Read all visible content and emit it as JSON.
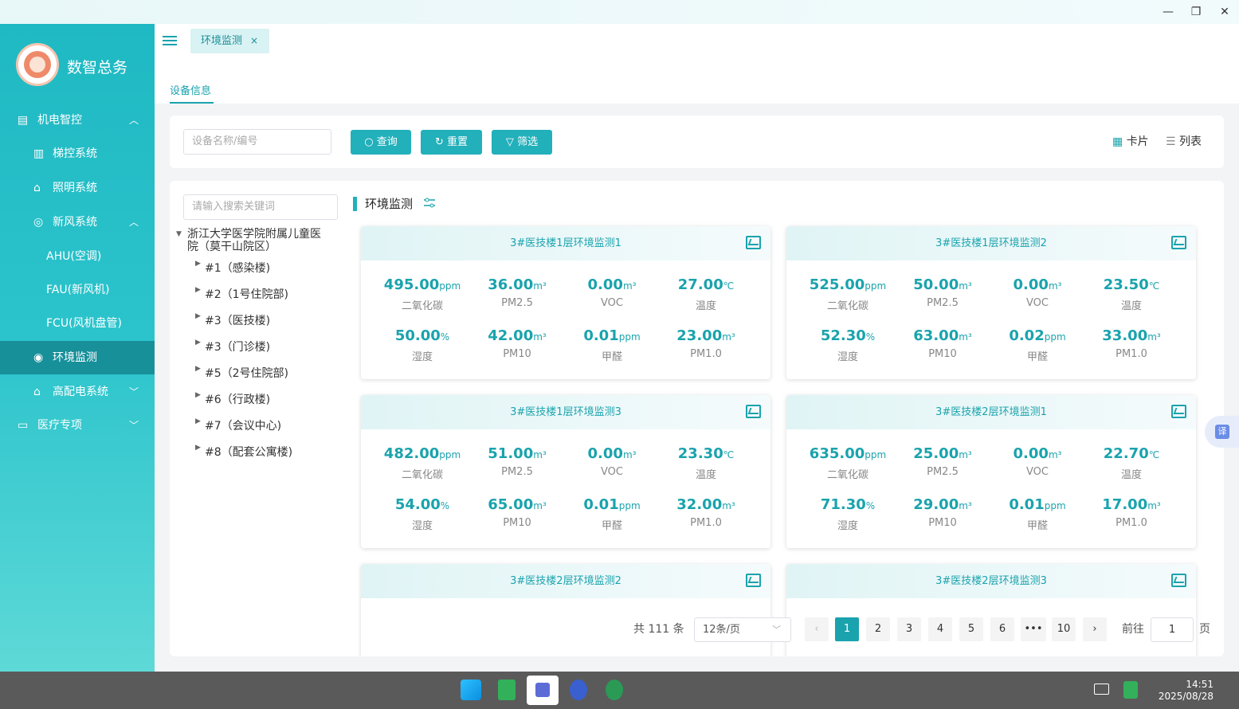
{
  "window": {
    "minimize": "—",
    "restore": "❐",
    "close": "✕"
  },
  "brand": "数智总务",
  "sidebar": {
    "items": [
      {
        "label": "机电智控",
        "icon": "building-icon",
        "chevron": "︿",
        "level": 1
      },
      {
        "label": "梯控系统",
        "icon": "elevator-icon",
        "level": 2
      },
      {
        "label": "照明系统",
        "icon": "lighting-icon",
        "level": 2
      },
      {
        "label": "新风系统",
        "icon": "fresh-air-icon",
        "chevron": "︿",
        "level": 2
      },
      {
        "label": "AHU(空调)",
        "level": 3
      },
      {
        "label": "FAU(新风机)",
        "level": 3
      },
      {
        "label": "FCU(风机盘管)",
        "level": 3
      },
      {
        "label": "环境监测",
        "icon": "eye-icon",
        "level": 2,
        "active": true
      },
      {
        "label": "高配电系统",
        "icon": "power-icon",
        "chevron": "﹀",
        "level": 2
      },
      {
        "label": "医疗专项",
        "icon": "monitor-icon",
        "chevron": "﹀",
        "level": 1
      }
    ]
  },
  "tabs": [
    {
      "label": "环境监测",
      "close": "×"
    }
  ],
  "subtab": "设备信息",
  "toolbar": {
    "search_placeholder": "设备名称/编号",
    "query_label": "查询",
    "reset_label": "重置",
    "filter_label": "筛选",
    "card_view": "卡片",
    "list_view": "列表"
  },
  "tree": {
    "search_placeholder": "请输入搜索关键词",
    "root": "浙江大学医学院附属儿童医院（莫干山院区）",
    "nodes": [
      "#1（感染楼)",
      "#2（1号住院部)",
      "#3（医技楼)",
      "#3（门诊楼)",
      "#5（2号住院部)",
      "#6（行政楼)",
      "#7（会议中心)",
      "#8（配套公寓楼)"
    ]
  },
  "section_title": "环境监测",
  "cards": [
    {
      "title": "3#医技楼1层环境监测1",
      "metrics": [
        {
          "value": "495.00",
          "unit": "ppm",
          "label": "二氧化碳"
        },
        {
          "value": "36.00",
          "unit": "m³",
          "label": "PM2.5"
        },
        {
          "value": "0.00",
          "unit": "m³",
          "label": "VOC"
        },
        {
          "value": "27.00",
          "unit": "℃",
          "label": "温度"
        },
        {
          "value": "50.00",
          "unit": "%",
          "label": "湿度"
        },
        {
          "value": "42.00",
          "unit": "m³",
          "label": "PM10"
        },
        {
          "value": "0.01",
          "unit": "ppm",
          "label": "甲醛"
        },
        {
          "value": "23.00",
          "unit": "m³",
          "label": "PM1.0"
        }
      ]
    },
    {
      "title": "3#医技楼1层环境监测2",
      "metrics": [
        {
          "value": "525.00",
          "unit": "ppm",
          "label": "二氧化碳"
        },
        {
          "value": "50.00",
          "unit": "m³",
          "label": "PM2.5"
        },
        {
          "value": "0.00",
          "unit": "m³",
          "label": "VOC"
        },
        {
          "value": "23.50",
          "unit": "℃",
          "label": "温度"
        },
        {
          "value": "52.30",
          "unit": "%",
          "label": "湿度"
        },
        {
          "value": "63.00",
          "unit": "m³",
          "label": "PM10"
        },
        {
          "value": "0.02",
          "unit": "ppm",
          "label": "甲醛"
        },
        {
          "value": "33.00",
          "unit": "m³",
          "label": "PM1.0"
        }
      ]
    },
    {
      "title": "3#医技楼1层环境监测3",
      "metrics": [
        {
          "value": "482.00",
          "unit": "ppm",
          "label": "二氧化碳"
        },
        {
          "value": "51.00",
          "unit": "m³",
          "label": "PM2.5"
        },
        {
          "value": "0.00",
          "unit": "m³",
          "label": "VOC"
        },
        {
          "value": "23.30",
          "unit": "℃",
          "label": "温度"
        },
        {
          "value": "54.00",
          "unit": "%",
          "label": "湿度"
        },
        {
          "value": "65.00",
          "unit": "m³",
          "label": "PM10"
        },
        {
          "value": "0.01",
          "unit": "ppm",
          "label": "甲醛"
        },
        {
          "value": "32.00",
          "unit": "m³",
          "label": "PM1.0"
        }
      ]
    },
    {
      "title": "3#医技楼2层环境监测1",
      "metrics": [
        {
          "value": "635.00",
          "unit": "ppm",
          "label": "二氧化碳"
        },
        {
          "value": "25.00",
          "unit": "m³",
          "label": "PM2.5"
        },
        {
          "value": "0.00",
          "unit": "m³",
          "label": "VOC"
        },
        {
          "value": "22.70",
          "unit": "℃",
          "label": "温度"
        },
        {
          "value": "71.30",
          "unit": "%",
          "label": "湿度"
        },
        {
          "value": "29.00",
          "unit": "m³",
          "label": "PM10"
        },
        {
          "value": "0.01",
          "unit": "ppm",
          "label": "甲醛"
        },
        {
          "value": "17.00",
          "unit": "m³",
          "label": "PM1.0"
        }
      ]
    },
    {
      "title": "3#医技楼2层环境监测2",
      "metrics": []
    },
    {
      "title": "3#医技楼2层环境监测3",
      "metrics": []
    }
  ],
  "pagination": {
    "total": "共 111 条",
    "page_size": "12条/页",
    "pages": [
      "1",
      "2",
      "3",
      "4",
      "5",
      "6",
      "•••",
      "10"
    ],
    "current": "1",
    "prev": "‹",
    "next": "›",
    "goto_label": "前往",
    "goto_value": "1",
    "goto_suffix": "页"
  },
  "taskbar": {
    "time": "14:51",
    "date": "2025/08/28"
  },
  "translate_label": "译",
  "colors": {
    "accent": "#1aa3ad",
    "sidebar_active": "#17909a"
  }
}
